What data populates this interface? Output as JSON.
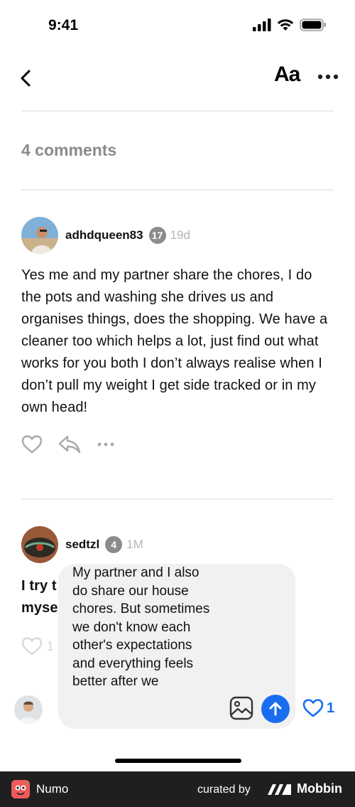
{
  "status_bar": {
    "time": "9:41"
  },
  "nav": {
    "font_button_label": "Aa"
  },
  "comments_header": {
    "count_label": "4 comments"
  },
  "comments": [
    {
      "username": "adhdqueen83",
      "badge": "17",
      "timestamp": "19d",
      "body": "Yes me and my partner share the chores, I do the pots and washing she drives us and organises things, does the shopping. We have a cleaner too which helps a lot, just find out what works for you both I don’t always realise when I don’t pull my weight I get side tracked or in my own head!"
    },
    {
      "username": "sedtzl",
      "badge": "4",
      "timestamp": "1M",
      "body_line1": "I try t",
      "body_line2": "myse",
      "like_count": "1"
    }
  ],
  "composer": {
    "text": "My partner and I also do share our house chores. But sometimes we don't know each other's expectations and everything feels better after we"
  },
  "bottom_bar": {
    "like_count": "1"
  },
  "footer": {
    "app_name": "Numo",
    "curated_by": "curated by",
    "brand": "Mobbin"
  },
  "colors": {
    "accent": "#1a6df0",
    "muted": "#8a8a8a",
    "footer_bg": "#1f1f1f"
  }
}
